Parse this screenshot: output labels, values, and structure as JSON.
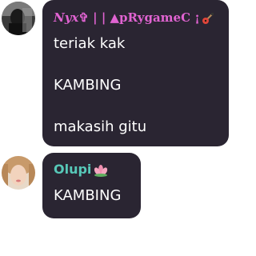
{
  "messages": [
    {
      "author": {
        "name_part1": "Nyx",
        "name_part2": "✞ | | ▲pRygameC ¡",
        "name_color": "#e063d1",
        "badge_icon": "guitar-icon"
      },
      "lines": [
        "teriak kak",
        "KAMBING",
        "makasih gitu"
      ]
    },
    {
      "author": {
        "name": "Olupi",
        "name_color": "#57c8b8",
        "badge_icon": "lotus-icon"
      },
      "lines": [
        "KAMBING"
      ]
    }
  ],
  "colors": {
    "bubble_bg": "#2a2532",
    "text": "#ffffff",
    "page_bg": "#ffffff"
  }
}
